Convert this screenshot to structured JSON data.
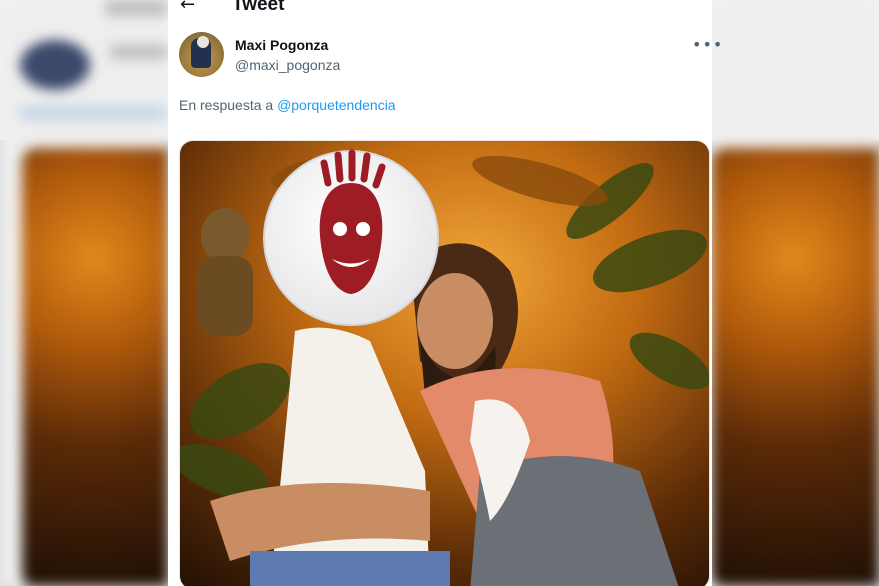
{
  "header": {
    "back_icon": "arrow-left-icon",
    "title": "Tweet"
  },
  "tweet": {
    "author_name": "Maxi Pogonza",
    "author_handle": "@maxi_pogonza",
    "more_icon": "more-horizontal-icon",
    "reply_prefix": "En respuesta a",
    "reply_to": "@porquetendencia",
    "link_color": "#1d9bf0",
    "media_description_icon": "photo-icon"
  }
}
